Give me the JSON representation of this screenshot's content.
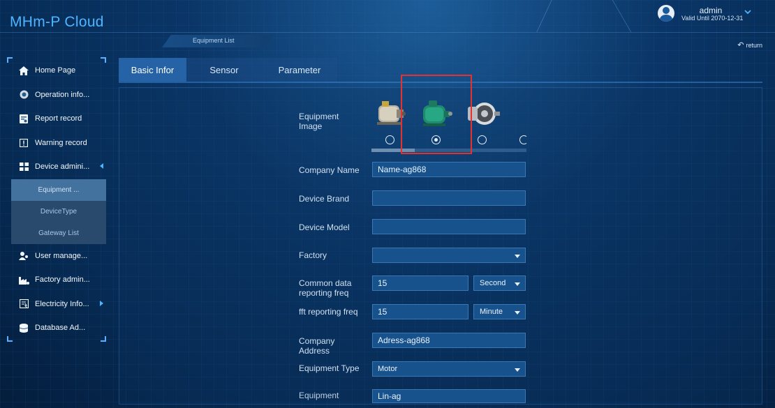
{
  "app": {
    "title": "MHm-P Cloud"
  },
  "breadcrumb": "Equipment List",
  "user": {
    "name": "admin",
    "valid_until": "Valid Until 2070-12-31"
  },
  "return_label": "return",
  "sidebar": {
    "items": [
      {
        "label": "Home Page",
        "icon": "home-icon"
      },
      {
        "label": "Operation info...",
        "icon": "camera-icon"
      },
      {
        "label": "Report record",
        "icon": "report-icon"
      },
      {
        "label": "Warning record",
        "icon": "warning-icon"
      },
      {
        "label": "Device admini...",
        "icon": "grid-icon",
        "expanded": true
      },
      {
        "label": "User manage...",
        "icon": "users-icon"
      },
      {
        "label": "Factory admin...",
        "icon": "factory-icon"
      },
      {
        "label": "Electricity Info...",
        "icon": "electricity-icon"
      },
      {
        "label": "Database Ad...",
        "icon": "database-icon"
      }
    ],
    "submenu": [
      {
        "label": "Equipment ...",
        "active": true
      },
      {
        "label": "DeviceType"
      },
      {
        "label": "Gateway List"
      }
    ]
  },
  "tabs": [
    {
      "label": "Basic Infor",
      "active": true
    },
    {
      "label": "Sensor"
    },
    {
      "label": "Parameter"
    }
  ],
  "form": {
    "equipment_image_label": "Equipment Image",
    "equipment_images": [
      {
        "name": "motor-silver-icon",
        "selected": false
      },
      {
        "name": "motor-green-icon",
        "selected": true
      },
      {
        "name": "motor-grey-icon",
        "selected": false
      }
    ],
    "company_name_label": "Company Name",
    "company_name_value": "Name-ag868",
    "device_brand_label": "Device Brand",
    "device_brand_value": "",
    "device_model_label": "Device Model",
    "device_model_value": "",
    "factory_label": "Factory",
    "factory_value": "",
    "common_freq_label": "Common data reporting freq",
    "common_freq_value": "15",
    "common_freq_unit": "Second",
    "fft_freq_label": "fft reporting freq",
    "fft_freq_value": "15",
    "fft_freq_unit": "Minute",
    "company_address_label": "Company Address",
    "company_address_value": "Adress-ag868",
    "equipment_type_label": "Equipment Type",
    "equipment_type_value": "Motor",
    "equipment_next_label": "Equipment",
    "equipment_next_value": "Lin-ag"
  },
  "colors": {
    "brand": "#4fb4ff",
    "highlight": "#e6322f",
    "tab_active": "#2563a6"
  }
}
